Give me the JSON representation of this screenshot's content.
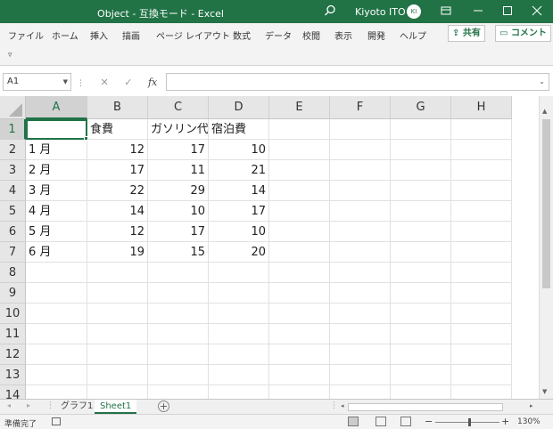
{
  "window": {
    "title": "Object - 互換モード - Excel",
    "user_name": "Kiyoto ITO",
    "user_initials": "KI"
  },
  "ribbon": {
    "tabs": [
      "ファイル",
      "ホーム",
      "挿入",
      "描画",
      "ページ レイアウト",
      "数式",
      "データ",
      "校閲",
      "表示",
      "開発",
      "ヘルプ"
    ],
    "share_label": "共有",
    "comment_label": "コメント"
  },
  "formula_bar": {
    "name_box": "A1",
    "fx_label": "fx",
    "formula": ""
  },
  "grid": {
    "columns": [
      "A",
      "B",
      "C",
      "D",
      "E",
      "F",
      "G",
      "H"
    ],
    "rows": [
      "1",
      "2",
      "3",
      "4",
      "5",
      "6",
      "7",
      "8",
      "9",
      "10",
      "11",
      "12",
      "13",
      "14"
    ],
    "data": [
      [
        "",
        "食費",
        "ガソリン代",
        "宿泊費"
      ],
      [
        "1 月",
        "12",
        "17",
        "10"
      ],
      [
        "2 月",
        "17",
        "11",
        "21"
      ],
      [
        "3 月",
        "22",
        "29",
        "14"
      ],
      [
        "4 月",
        "14",
        "10",
        "17"
      ],
      [
        "5 月",
        "12",
        "17",
        "10"
      ],
      [
        "6 月",
        "19",
        "15",
        "20"
      ]
    ]
  },
  "sheets": {
    "tabs": [
      "グラフ1",
      "Sheet1"
    ],
    "active": "Sheet1"
  },
  "status": {
    "ready": "準備完了",
    "zoom": "130%"
  },
  "colors": {
    "accent": "#217346"
  }
}
